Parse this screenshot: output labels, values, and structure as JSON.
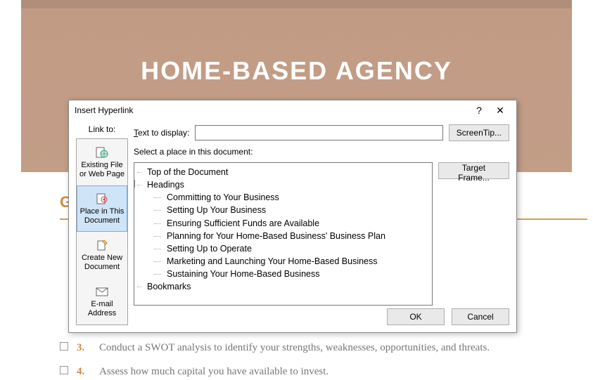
{
  "background": {
    "hero_title": "HOME-BASED AGENCY",
    "section_head_partial": "G",
    "list_item_3_text": "Conduct a SWOT analysis to identify your strengths, weaknesses, opportunities, and threats.",
    "list_item_3_num": "3.",
    "list_item_4_text": "Assess how much capital you have available to invest.",
    "list_item_4_num": "4."
  },
  "dialog": {
    "title": "Insert Hyperlink",
    "help": "?",
    "close": "✕",
    "link_to_label": "Link to:",
    "links": {
      "existing": "Existing File or Web Page",
      "place": "Place in This Document",
      "createnew": "Create New Document",
      "email": "E-mail Address"
    },
    "text_to_display_label": "Text to display:",
    "text_to_display_value": "",
    "screentip_btn": "ScreenTip...",
    "select_place_label": "Select a place in this document:",
    "target_frame_btn": "Target Frame...",
    "tree": {
      "top": "Top of the Document",
      "headings": "Headings",
      "h1": "Committing to Your Business",
      "h2": "Setting Up Your Business",
      "h3": "Ensuring Sufficient Funds are Available",
      "h4": "Planning for Your Home-Based Business' Business Plan",
      "h5": "Setting Up to Operate",
      "h6": "Marketing and Launching Your Home-Based Business",
      "h7": "Sustaining Your Home-Based Business",
      "bookmarks": "Bookmarks"
    },
    "ok_btn": "OK",
    "cancel_btn": "Cancel"
  }
}
